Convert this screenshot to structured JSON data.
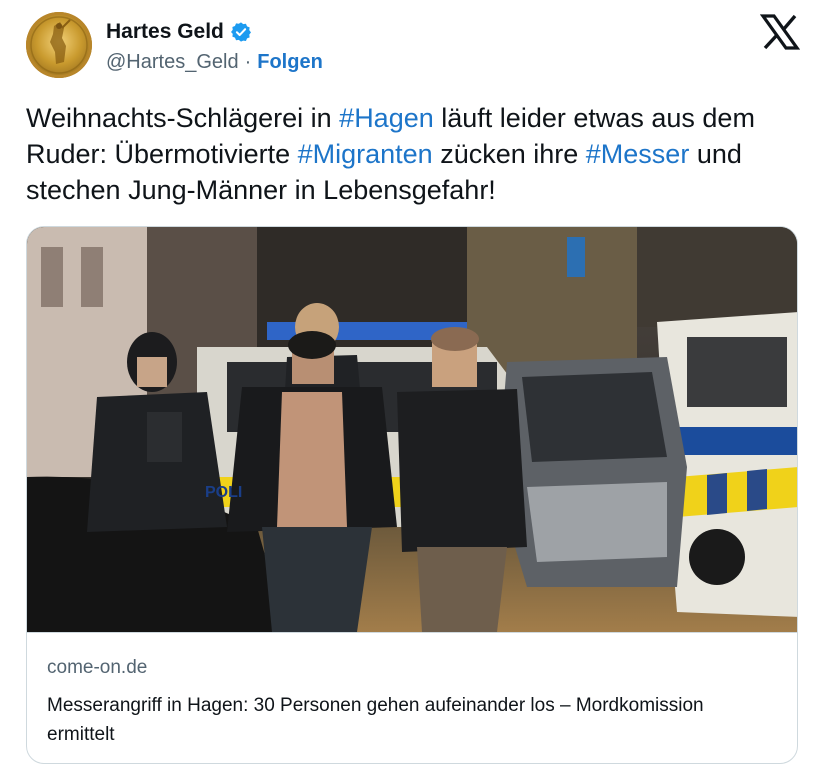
{
  "author": {
    "name": "Hartes Geld",
    "handle": "@Hartes_Geld",
    "separator": "·",
    "follow_label": "Folgen"
  },
  "tweet": {
    "segments": [
      {
        "text": "Weihnachts-Schlägerei in ",
        "hashtag": false
      },
      {
        "text": "#Hagen",
        "hashtag": true
      },
      {
        "text": " läuft leider etwas aus dem Ruder: Übermotivierte ",
        "hashtag": false
      },
      {
        "text": "#Migranten",
        "hashtag": true
      },
      {
        "text": " zücken ihre ",
        "hashtag": false
      },
      {
        "text": "#Messer",
        "hashtag": true
      },
      {
        "text": " und stechen Jung-Männer in Lebensgefahr!",
        "hashtag": false
      }
    ]
  },
  "card": {
    "domain": "come-on.de",
    "title": "Messerangriff in Hagen: 30 Personen gehen aufeinander los – Mordkomission ermittelt",
    "image_text": "POLI"
  },
  "icons": {
    "verified": "verified-badge-icon",
    "x_logo": "x-logo-icon"
  },
  "colors": {
    "link": "#1d75c9",
    "text": "#0f1419",
    "secondary": "#536471",
    "border": "#cfd9de",
    "verified": "#1d9bf0"
  }
}
